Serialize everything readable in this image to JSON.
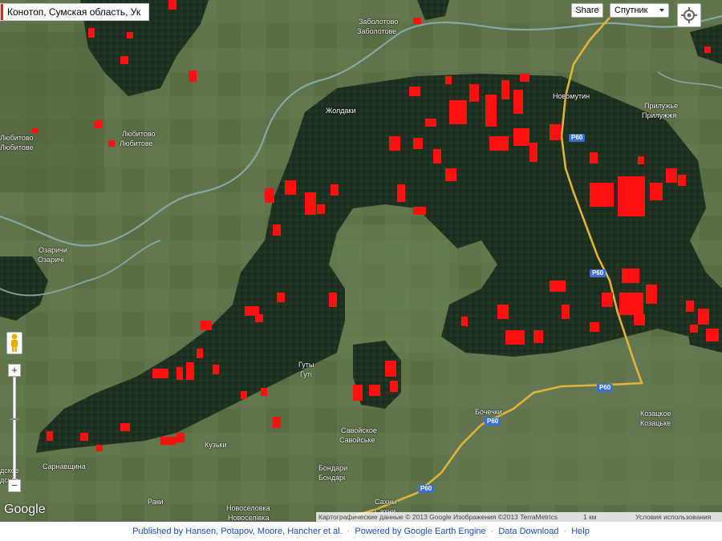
{
  "search": {
    "value": "Конотоп, Сумская область, Ук"
  },
  "controls": {
    "share_label": "Share",
    "maptype_label": "Спутник",
    "zoom_in_symbol": "+",
    "zoom_out_symbol": "−"
  },
  "places": [
    {
      "name": "Заболотово"
    },
    {
      "name": "Заболотове"
    },
    {
      "name": "Новомутин"
    },
    {
      "name": "Прилужье"
    },
    {
      "name": "Прилужжя"
    },
    {
      "name": "Жолдаки"
    },
    {
      "name": "Любитово"
    },
    {
      "name": "Любитове"
    },
    {
      "name": "Любитово"
    },
    {
      "name": "Любитове"
    },
    {
      "name": "Озаричи"
    },
    {
      "name": "Озаричі"
    },
    {
      "name": "Гуты"
    },
    {
      "name": "Гуті"
    },
    {
      "name": "Бочечки"
    },
    {
      "name": "Козацкое"
    },
    {
      "name": "Козацьке"
    },
    {
      "name": "Савойское"
    },
    {
      "name": "Савойське"
    },
    {
      "name": "Кузьки"
    },
    {
      "name": "Сарнавщина"
    },
    {
      "name": "Бондари"
    },
    {
      "name": "Бондарі"
    },
    {
      "name": "Раки"
    },
    {
      "name": "Новоселовка"
    },
    {
      "name": "Новоселівка"
    },
    {
      "name": "Сахны"
    },
    {
      "name": "Сахни"
    },
    {
      "name": "дское"
    },
    {
      "name": "дське"
    }
  ],
  "road_shields": [
    "P60",
    "P60",
    "P60",
    "P60",
    "P60"
  ],
  "logo": "Google",
  "attribution": {
    "data": "Картографические данные © 2013 Google Изображения ©2013 TerraMetrics",
    "scale": "1 км",
    "terms": "Условия использования"
  },
  "footer": {
    "published": "Published by Hansen, Potapov, Moore, Hancher et al.",
    "powered": "Powered by Google Earth Engine",
    "download": "Data Download",
    "help": "Help"
  },
  "colors": {
    "forest": "#1f3320",
    "field": "#5d7248",
    "forest_loss": "#ff1010",
    "road": "#e0b43a",
    "river": "#8aa6a0",
    "footer_link": "#1a4fb8"
  }
}
